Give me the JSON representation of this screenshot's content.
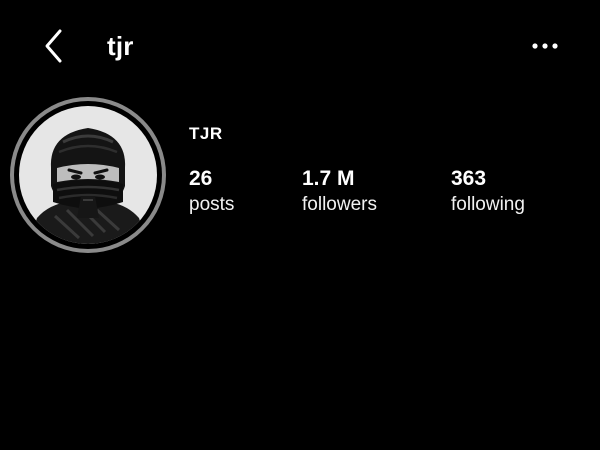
{
  "header": {
    "back_icon": "chevron-left-icon",
    "username": "tjr",
    "more_icon": "more-horizontal-icon"
  },
  "profile": {
    "display_name": "TJR",
    "avatar_description": "avatar",
    "stats": {
      "posts": {
        "value": "26",
        "label": "posts"
      },
      "followers": {
        "value": "1.7 M",
        "label": "followers"
      },
      "following": {
        "value": "363",
        "label": "following"
      }
    }
  },
  "colors": {
    "background": "#000000",
    "text": "#ffffff",
    "avatar_ring": "#8a8a8a"
  }
}
